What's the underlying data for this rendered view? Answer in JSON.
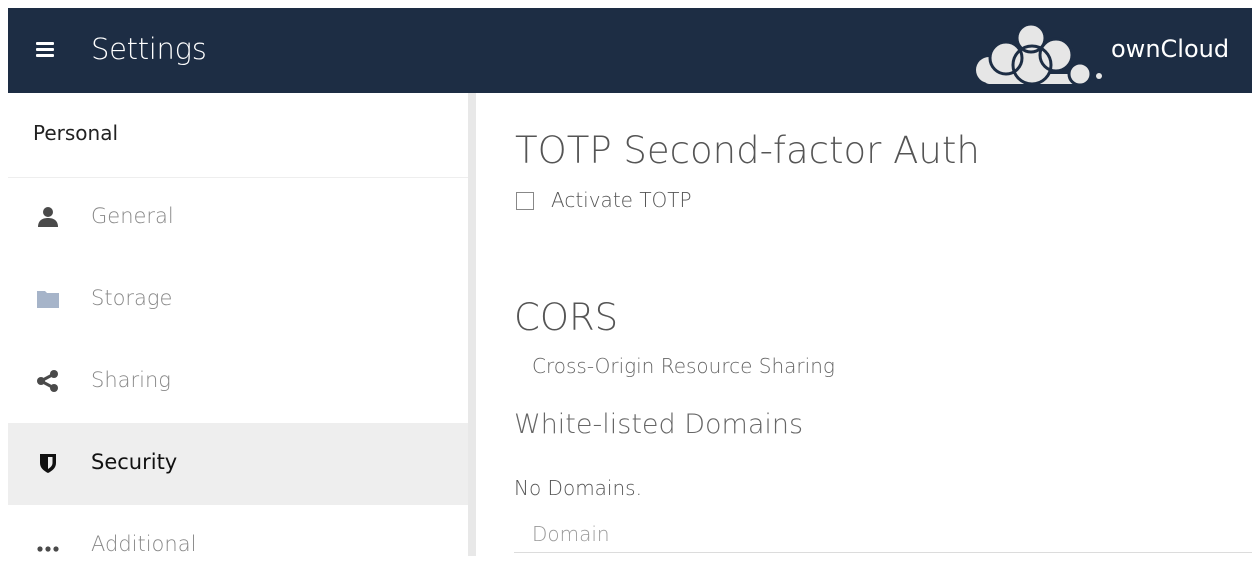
{
  "header": {
    "title": "Settings",
    "brand": "ownCloud",
    "menu_icon": "hamburger-icon",
    "logo_icon": "owncloud-logo-icon",
    "bg_color": "#1d2d44"
  },
  "sidebar": {
    "heading": "Personal",
    "items": [
      {
        "label": "General",
        "icon": "user-icon",
        "active": false
      },
      {
        "label": "Storage",
        "icon": "folder-icon",
        "active": false
      },
      {
        "label": "Sharing",
        "icon": "share-icon",
        "active": false
      },
      {
        "label": "Security",
        "icon": "shield-icon",
        "active": true
      },
      {
        "label": "Additional",
        "icon": "more-icon",
        "active": false
      }
    ]
  },
  "content": {
    "totp": {
      "title": "TOTP Second-factor Auth",
      "checkbox_label": "Activate TOTP",
      "checked": false
    },
    "cors": {
      "title": "CORS",
      "description": "Cross-Origin Resource Sharing",
      "whitelist_title": "White-listed Domains",
      "empty_text": "No Domains.",
      "domain_placeholder": "Domain",
      "domain_value": ""
    }
  }
}
